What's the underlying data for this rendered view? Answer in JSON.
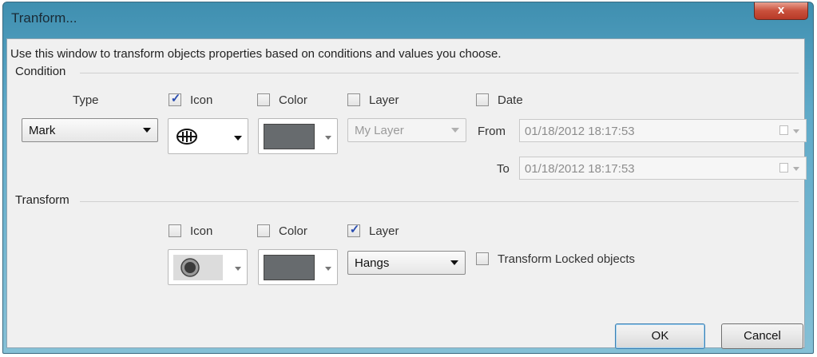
{
  "window": {
    "title": "Tranform...",
    "close_label": "x"
  },
  "description": "Use this window to transform objects properties based on conditions and values you choose.",
  "condition": {
    "group_label": "Condition",
    "type_label": "Type",
    "type_value": "Mark",
    "icon_label": "Icon",
    "icon_checked": true,
    "icon_value": "mark-symbol-icon",
    "color_label": "Color",
    "color_checked": false,
    "color_value": "#676b6e",
    "layer_label": "Layer",
    "layer_checked": false,
    "layer_value": "My Layer",
    "date_label": "Date",
    "date_checked": false,
    "from_label": "From",
    "from_value": "01/18/2012 18:17:53",
    "to_label": "To",
    "to_value": "01/18/2012 18:17:53"
  },
  "transform": {
    "group_label": "Transform",
    "icon_label": "Icon",
    "icon_checked": false,
    "icon_value": "circle-symbol-icon",
    "color_label": "Color",
    "color_checked": false,
    "color_value": "#676b6e",
    "layer_label": "Layer",
    "layer_checked": true,
    "layer_value": "Hangs",
    "locked_label": "Transform Locked objects",
    "locked_checked": false
  },
  "buttons": {
    "ok": "OK",
    "cancel": "Cancel"
  }
}
